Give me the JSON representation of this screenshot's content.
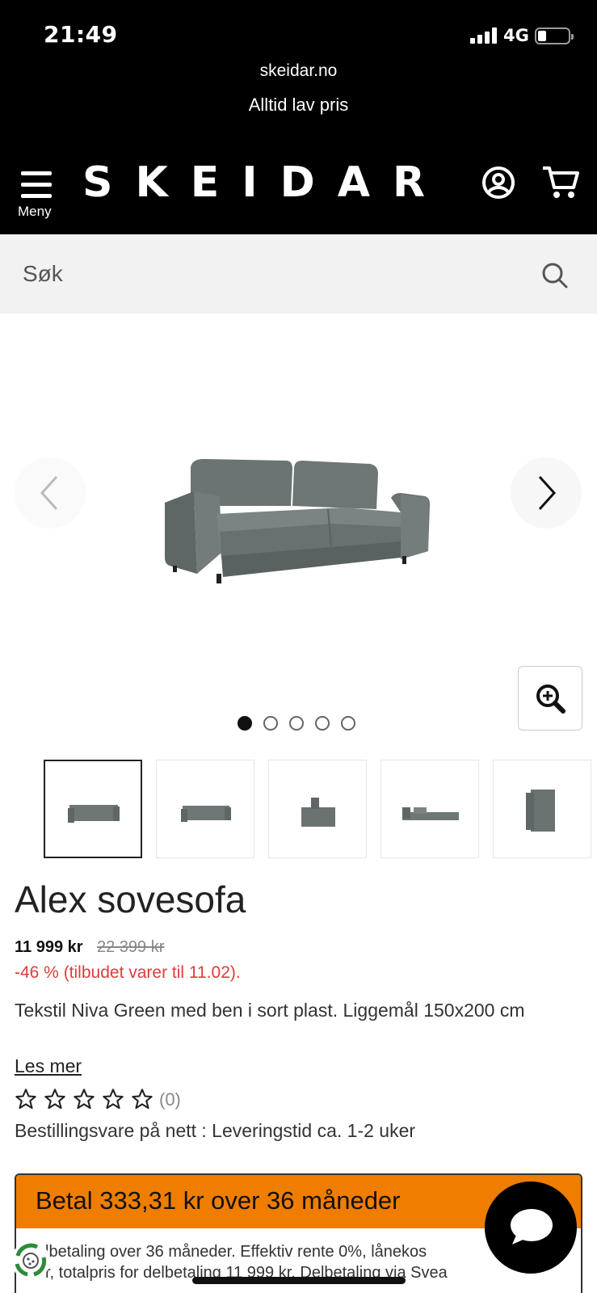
{
  "status_bar": {
    "time": "21:49",
    "network": "4G"
  },
  "header": {
    "domain": "skeidar.no",
    "tagline": "Alltid lav pris",
    "menu_label": "Meny",
    "logo": "SKEIDAR"
  },
  "search": {
    "placeholder": "Søk"
  },
  "gallery": {
    "image_count": 5,
    "active_index": 0,
    "thumbnails": 5
  },
  "product": {
    "title": "Alex sovesofa",
    "price": "11 999 kr",
    "old_price": "22 399 kr",
    "discount": "-46 % (tilbudet varer til 11.02).",
    "description": "Tekstil Niva Green med ben i sort plast. Liggemål 150x200 cm",
    "read_more": "Les mer",
    "rating": {
      "stars": 0,
      "max": 5,
      "count": "(0)"
    },
    "delivery": "Bestillingsvare på nett : Leveringstid ca. 1-2 uker"
  },
  "payment": {
    "title": "Betal 333,31 kr over 36 måneder",
    "line1": "lbetaling over 36 måneder. Effektiv rente 0%, lånekos",
    "line2": "r, totalpris for delbetaling 11 999 kr. Delbetaling via Svea"
  },
  "colors": {
    "accent": "#ee7d00",
    "discount": "#e03b3b",
    "header_bg": "#000000"
  }
}
